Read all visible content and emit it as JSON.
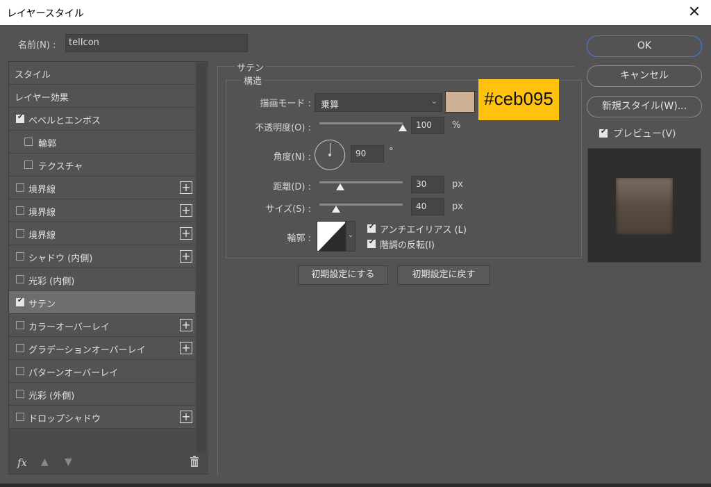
{
  "window": {
    "title": "レイヤースタイル"
  },
  "name": {
    "label": "名前(N) :",
    "value": "telIcon"
  },
  "styles": [
    {
      "label": "スタイル",
      "checkbox": false,
      "checked": false,
      "indent": 0,
      "plus": false
    },
    {
      "label": "レイヤー効果",
      "checkbox": false,
      "checked": false,
      "indent": 0,
      "plus": false
    },
    {
      "label": "ベベルとエンボス",
      "checkbox": true,
      "checked": true,
      "indent": 0,
      "plus": false
    },
    {
      "label": "輪郭",
      "checkbox": true,
      "checked": false,
      "indent": 1,
      "plus": false
    },
    {
      "label": "テクスチャ",
      "checkbox": true,
      "checked": false,
      "indent": 1,
      "plus": false
    },
    {
      "label": "境界線",
      "checkbox": true,
      "checked": false,
      "indent": 0,
      "plus": true
    },
    {
      "label": "境界線",
      "checkbox": true,
      "checked": false,
      "indent": 0,
      "plus": true
    },
    {
      "label": "境界線",
      "checkbox": true,
      "checked": false,
      "indent": 0,
      "plus": true
    },
    {
      "label": "シャドウ (内側)",
      "checkbox": true,
      "checked": false,
      "indent": 0,
      "plus": true
    },
    {
      "label": "光彩 (内側)",
      "checkbox": true,
      "checked": false,
      "indent": 0,
      "plus": false
    },
    {
      "label": "サテン",
      "checkbox": true,
      "checked": true,
      "indent": 0,
      "plus": false,
      "selected": true
    },
    {
      "label": "カラーオーバーレイ",
      "checkbox": true,
      "checked": false,
      "indent": 0,
      "plus": true
    },
    {
      "label": "グラデーションオーバーレイ",
      "checkbox": true,
      "checked": false,
      "indent": 0,
      "plus": true
    },
    {
      "label": "パターンオーバーレイ",
      "checkbox": true,
      "checked": false,
      "indent": 0,
      "plus": false
    },
    {
      "label": "光彩 (外側)",
      "checkbox": true,
      "checked": false,
      "indent": 0,
      "plus": false
    },
    {
      "label": "ドロップシャドウ",
      "checkbox": true,
      "checked": false,
      "indent": 0,
      "plus": true
    }
  ],
  "footer": {
    "fx": "fx",
    "up_icon": "arrow-up-icon",
    "down_icon": "arrow-down-icon",
    "trash_icon": "trash-icon"
  },
  "satin": {
    "section_title": "サテン",
    "group_title": "構造",
    "blend_mode": {
      "label": "描画モード :",
      "value": "乗算",
      "color": "#ceb095"
    },
    "opacity": {
      "label": "不透明度(O) :",
      "value": "100",
      "unit": "%",
      "level": 1.0
    },
    "angle": {
      "label": "角度(N) :",
      "value": "90",
      "unit": "°"
    },
    "distance": {
      "label": "距離(D) :",
      "value": "30",
      "unit": "px",
      "level": 0.25
    },
    "size": {
      "label": "サイズ(S) :",
      "value": "40",
      "unit": "px",
      "level": 0.2
    },
    "contour": {
      "label": "輪郭 :"
    },
    "antialias": {
      "label": "アンチエイリアス (L)",
      "checked": true
    },
    "invert": {
      "label": "階調の反転(I)",
      "checked": true
    },
    "buttons": {
      "make_default": "初期設定にする",
      "reset_default": "初期設定に戻す"
    }
  },
  "callout": {
    "text": "#ceb095"
  },
  "actions": {
    "ok": "OK",
    "cancel": "キャンセル",
    "new_style": "新規スタイル(W)...",
    "preview": "プレビュー(V)",
    "preview_checked": true
  },
  "colors": {
    "accent": "#3f7fd4",
    "callout_bg": "#ffc20e",
    "swatch": "#ceb095"
  }
}
